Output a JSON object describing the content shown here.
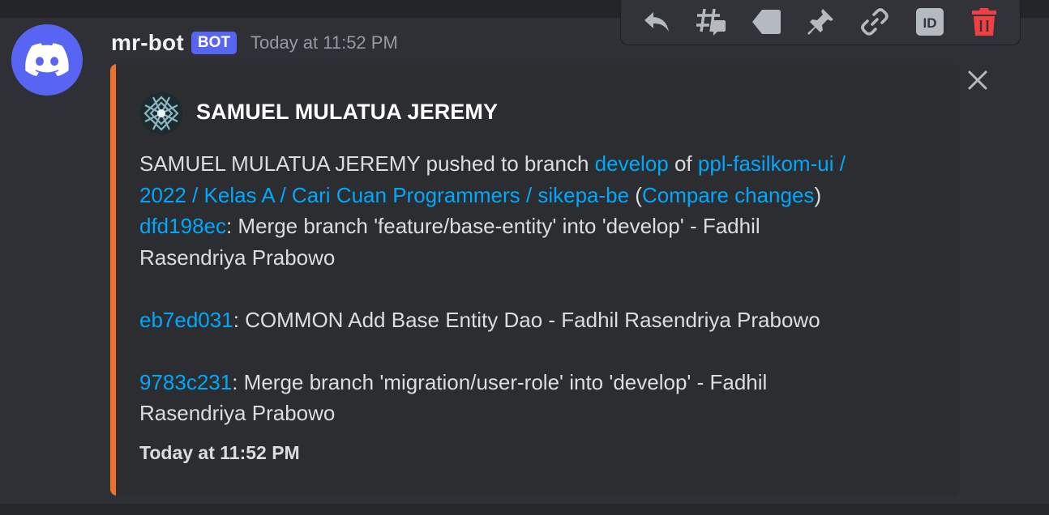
{
  "message": {
    "username": "mr-bot",
    "badge": "BOT",
    "timestamp": "Today at 11:52 PM"
  },
  "toolbar": {
    "icons": [
      "reply-icon",
      "create-thread-icon",
      "apps-icon",
      "pin-icon",
      "copy-link-icon",
      "copy-id-icon",
      "delete-icon"
    ],
    "id_label": "ID",
    "delete_color": "#f23f42"
  },
  "embed": {
    "accent_color": "#f0712c",
    "author": "SAMUEL MULATUA JEREMY",
    "description": {
      "actor": "SAMUEL MULATUA JEREMY",
      "pushed_to": " pushed to branch ",
      "branch": "develop",
      "of": " of ",
      "repo_line1": "ppl-fasilkom-ui /",
      "repo_line2": "2022 / Kelas A / Cari Cuan Programmers / sikepa-be",
      "paren_open": " (",
      "compare": "Compare changes",
      "paren_close": ")"
    },
    "commits": [
      {
        "hash": "dfd198ec",
        "line1": ": Merge branch 'feature/base-entity' into 'develop' - Fadhil",
        "line2": "Rasendriya Prabowo"
      },
      {
        "hash": "eb7ed031",
        "line1": ": COMMON Add Base Entity Dao - Fadhil Rasendriya Prabowo"
      },
      {
        "hash": "9783c231",
        "line1": ": Merge branch 'migration/user-role' into 'develop' - Fadhil",
        "line2": "Rasendriya Prabowo"
      }
    ],
    "footer": "Today at 11:52 PM"
  }
}
